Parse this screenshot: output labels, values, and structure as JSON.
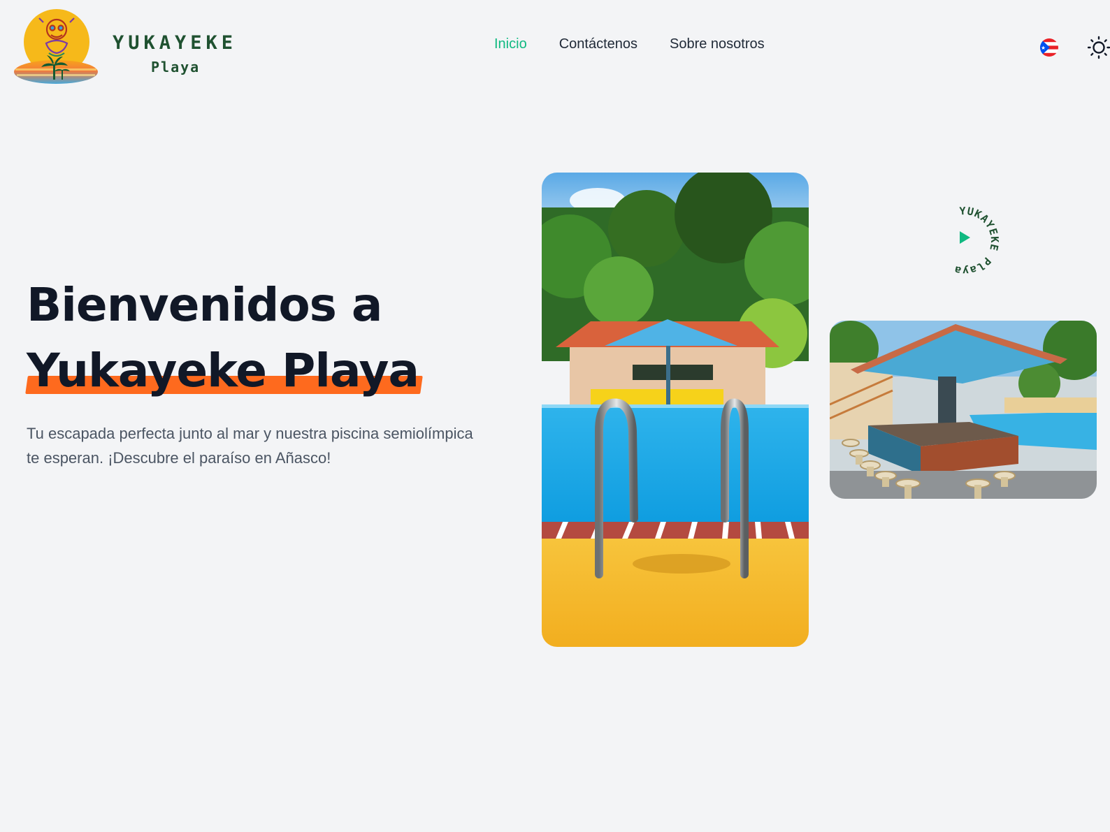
{
  "header": {
    "logo": {
      "word_1": "YUKAYEKE",
      "word_2": "Playa",
      "icon": "taino-sun-logo-icon"
    },
    "nav": [
      {
        "label": "Inicio",
        "active": true
      },
      {
        "label": "Contáctenos",
        "active": false
      },
      {
        "label": "Sobre nosotros",
        "active": false
      }
    ],
    "language_icon": "puerto-rico-flag-icon",
    "theme_icon": "sun-icon"
  },
  "hero": {
    "title_line_1": "Bienvenidos a",
    "title_line_2": "Yukayeke Playa",
    "subtitle": "Tu escapada perfecta junto al mar y nuestra piscina semiolímpica te esperan. ¡Descubre el paraíso en Añasco!"
  },
  "badge": {
    "text": "YUKAYEKE Playa",
    "icon": "play-icon"
  },
  "colors": {
    "accent": "#10b981",
    "highlight": "#fe6a1e",
    "heading": "#111827",
    "body_text": "#4b5563",
    "background": "#f3f4f6",
    "logo_text": "#1f5130"
  }
}
